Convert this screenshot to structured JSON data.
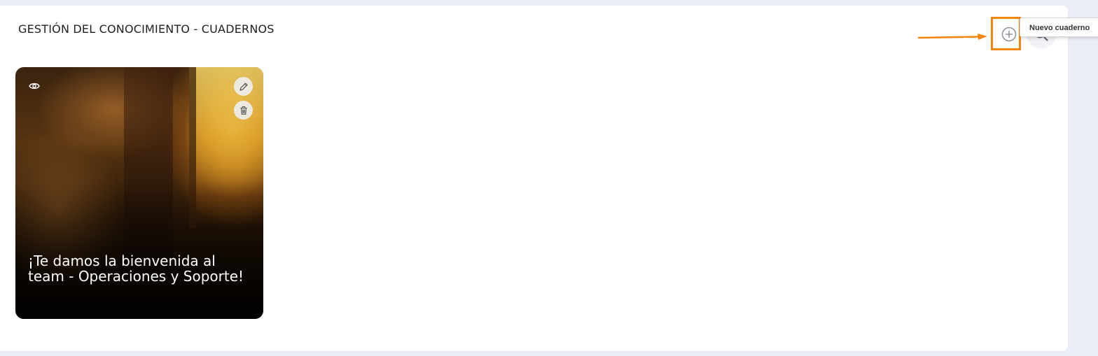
{
  "page": {
    "title": "GESTIÓN DEL CONOCIMIENTO - CUADERNOS"
  },
  "toolbar": {
    "add_icon": "plus-circle-icon",
    "search_icon": "search-icon",
    "tooltip": "Nuevo cuaderno",
    "highlight_color": "#f5860c"
  },
  "notebooks": [
    {
      "title": "¡Te damos la bienvenida al team - Operaciones y Soporte!",
      "icons": {
        "view": "eye-icon",
        "edit": "pencil-icon",
        "delete": "trash-icon"
      }
    }
  ]
}
